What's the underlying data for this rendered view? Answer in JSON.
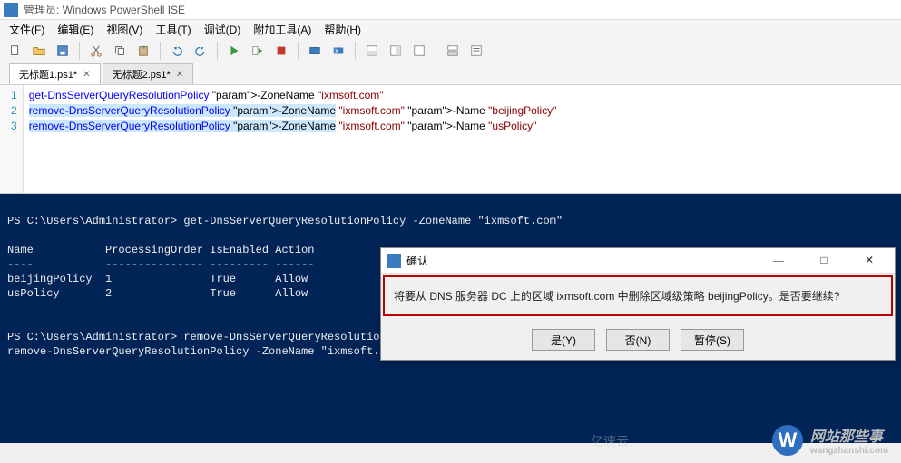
{
  "title": "管理员: Windows PowerShell ISE",
  "menu": [
    "文件(F)",
    "编辑(E)",
    "视图(V)",
    "工具(T)",
    "调试(D)",
    "附加工具(A)",
    "帮助(H)"
  ],
  "tabs": [
    {
      "label": "无标题1.ps1*",
      "active": true
    },
    {
      "label": "无标题2.ps1*",
      "active": false
    }
  ],
  "editor": {
    "lines": [
      {
        "n": 1,
        "cmd": "get-DnsServerQueryResolutionPolicy",
        "rest": " -ZoneName \"ixmsoft.com\""
      },
      {
        "n": 2,
        "cmd": "remove-DnsServerQueryResolutionPolicy",
        "rest": " -ZoneName \"ixmsoft.com\" -Name \"beijingPolicy\"",
        "hl": true
      },
      {
        "n": 3,
        "cmd": "remove-DnsServerQueryResolutionPolicy",
        "rest": " -ZoneName \"ixmsoft.com\" -Name \"usPolicy\"",
        "hl": true
      }
    ]
  },
  "console": {
    "prompt1": "PS C:\\Users\\Administrator> get-DnsServerQueryResolutionPolicy -ZoneName \"ixmsoft.com\"",
    "cols": "Name           ProcessingOrder IsEnabled Action",
    "sep": "----           --------------- --------- ------",
    "rows": [
      "beijingPolicy  1               True      Allow",
      "usPolicy       2               True      Allow"
    ],
    "prompt2": "PS C:\\Users\\Administrator> remove-DnsServerQueryResolutionPolicy -ZoneName \"ixmsoft.com\" -Name \"beijingPolicy\"",
    "prompt3": "remove-DnsServerQueryResolutionPolicy -ZoneName \"ixmsoft.com\" -Name \"usPolicy\""
  },
  "dialog": {
    "title": "确认",
    "message": "将要从 DNS 服务器 DC 上的区域 ixmsoft.com 中删除区域级策略 beijingPolicy。是否要继续?",
    "btn_yes": "是(Y)",
    "btn_no": "否(N)",
    "btn_pause": "暂停(S)"
  },
  "watermark": {
    "text": "网站那些事",
    "sub": "wangzhanshi.com",
    "alt": "亿速云"
  }
}
